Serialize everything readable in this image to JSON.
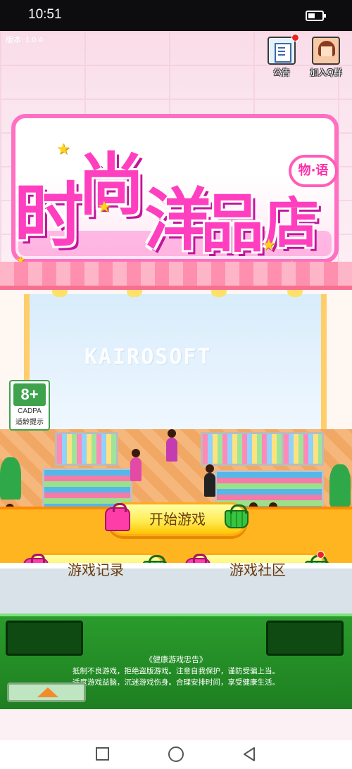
{
  "status_bar": {
    "time": "10:51"
  },
  "game": {
    "version": "版本: 1.0.4",
    "top_buttons": {
      "notice_label": "公告",
      "qq_label": "加入Q群"
    },
    "logo": {
      "chars": [
        "时",
        "尚",
        "洋",
        "品",
        "店"
      ],
      "badge": "物·语"
    },
    "watermark": "KAIROSOFT",
    "rating": {
      "age": "8+",
      "org": "CADPA",
      "tip": "适龄提示"
    },
    "buttons": {
      "start": "开始游戏",
      "records": "游戏记录",
      "community": "游戏社区"
    },
    "advice": {
      "title": "《健康游戏忠告》",
      "line1": "抵制不良游戏，拒绝盗版游戏。注意自我保护，谨防受骗上当。",
      "line2": "适度游戏益脑，沉迷游戏伤身。合理安排时间，享受健康生活。"
    }
  },
  "colors": {
    "brand_pink": "#ff3fbf",
    "button_yellow": "#ffe94d",
    "panel_green": "#1e7f21"
  }
}
